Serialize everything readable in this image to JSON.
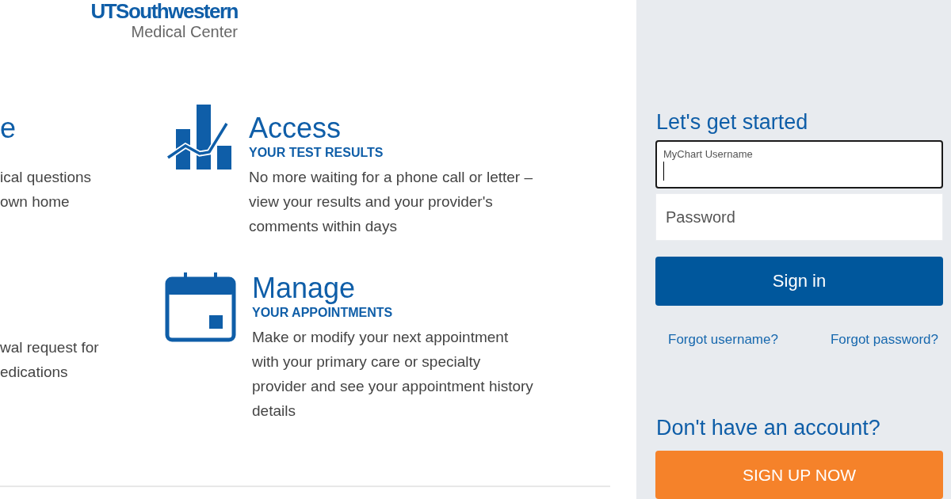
{
  "logo": {
    "name": "UTSouthwestern",
    "subtitle": "Medical Center"
  },
  "left_features": [
    {
      "title": "e",
      "body": "ical questions\nown home"
    },
    {
      "body": "wal request for\nedications"
    }
  ],
  "right_features": [
    {
      "kind": "chart",
      "title": "Access",
      "subtitle": "YOUR TEST RESULTS",
      "body": "No more waiting for a phone call or letter –\nview your results and your provider's\ncomments within days"
    },
    {
      "kind": "calendar",
      "title": "Manage",
      "subtitle": "YOUR APPOINTMENTS",
      "body": "Make or modify your next appointment\nwith your primary care or specialty\nprovider and see your appointment history\ndetails"
    }
  ],
  "login": {
    "heading": "Let's get started",
    "fields": [
      {
        "kind": "floating",
        "label": "MyChart Username",
        "focused": true
      },
      {
        "kind": "plain",
        "placeholder": "Password",
        "focused": false
      }
    ],
    "sign_in": "Sign in",
    "links": [
      "Forgot username?",
      "Forgot password?"
    ],
    "signup_heading": "Don't have an account?",
    "signup": "SIGN UP NOW"
  }
}
